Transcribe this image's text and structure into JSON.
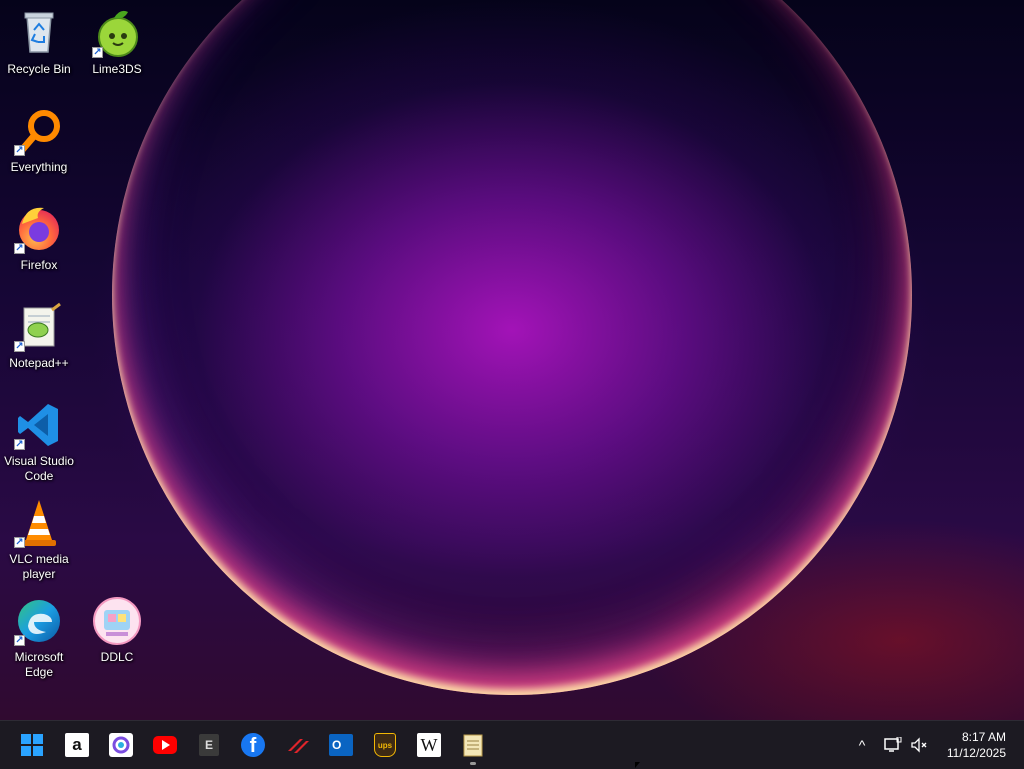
{
  "desktop": {
    "icons": [
      {
        "label": "Recycle Bin",
        "icon": "recycle-bin-icon"
      },
      {
        "label": "Lime3DS",
        "icon": "lime3ds-icon"
      },
      {
        "label": "Everything",
        "icon": "everything-search-icon"
      },
      {
        "label": "Firefox",
        "icon": "firefox-icon"
      },
      {
        "label": "Notepad++",
        "icon": "notepad-plus-plus-icon"
      },
      {
        "label": "Visual Studio Code",
        "icon": "vscode-icon"
      },
      {
        "label": "VLC media player",
        "icon": "vlc-icon"
      },
      {
        "label": "Microsoft Edge",
        "icon": "edge-icon"
      },
      {
        "label": "DDLC",
        "icon": "ddlc-icon"
      }
    ]
  },
  "taskbar": {
    "pinned": [
      {
        "icon": "windows-start-icon"
      },
      {
        "icon": "amazon-icon",
        "text": "a"
      },
      {
        "icon": "copilot-icon"
      },
      {
        "icon": "youtube-icon"
      },
      {
        "icon": "epic-games-icon",
        "text": "E"
      },
      {
        "icon": "facebook-icon",
        "text": "f"
      },
      {
        "icon": "red-app-icon"
      },
      {
        "icon": "outlook-icon",
        "text": "O"
      },
      {
        "icon": "ups-icon",
        "text": "ups"
      },
      {
        "icon": "wikipedia-icon",
        "text": "W"
      },
      {
        "icon": "notepad-icon"
      }
    ],
    "tray": {
      "chevron": "^",
      "time": "8:17 AM",
      "date": "11/12/2025"
    }
  },
  "colors": {
    "taskbar_bg": "#1c1a22",
    "accent_blue": "#1a8cff"
  }
}
